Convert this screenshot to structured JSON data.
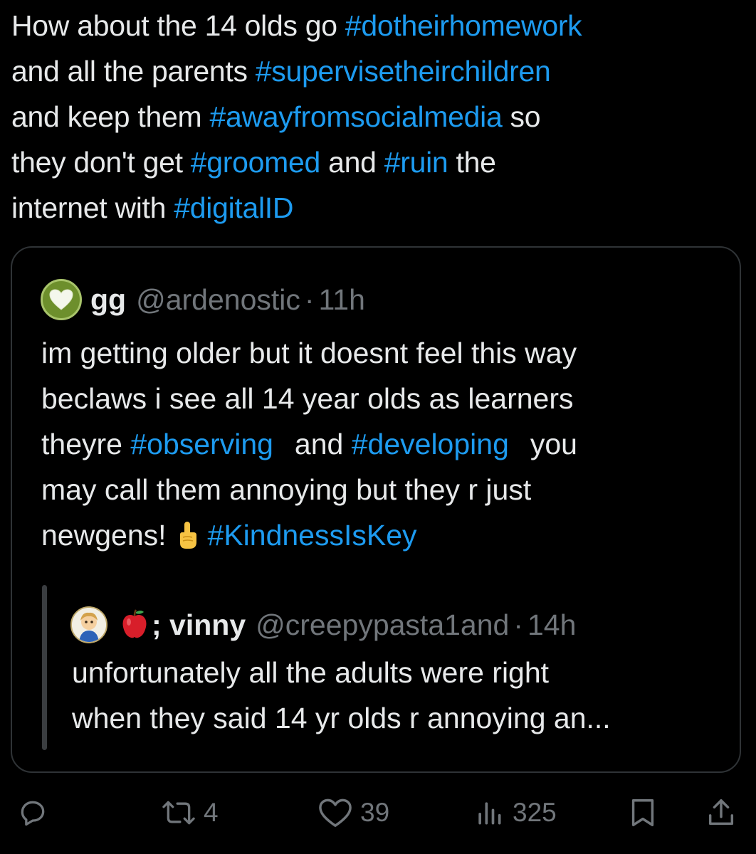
{
  "tweet": {
    "line1": {
      "t1": "How about the 14 olds go ",
      "h1": "#dotheirhomework"
    },
    "line2": {
      "t1": "and all the parents ",
      "h1": "#supervisetheirchildren"
    },
    "line3": {
      "t1": "and keep them ",
      "h1": "#awayfromsocialmedia",
      "t2": " so"
    },
    "line4": {
      "t1": "they don't get ",
      "h1": "#groomed",
      "t2": " and ",
      "h2": "#ruin",
      "t3": " the"
    },
    "line5": {
      "t1": "internet with ",
      "h1": "#digitalID"
    }
  },
  "quote": {
    "name": "gg",
    "handle": "@ardenostic",
    "dot": "·",
    "time": "11h",
    "line1": "im getting older but it doesnt feel this way",
    "line2": "beclaws i see all 14 year olds as learners",
    "line3": {
      "t1": "theyre ",
      "h1": "#observing",
      "t2": "and ",
      "h2": "#developing",
      "t3": "you"
    },
    "line4": "may call them annoying but they r just",
    "line5": {
      "t1": "newgens!",
      "h1": "#KindnessIsKey"
    }
  },
  "nested_quote": {
    "name": "; vinny",
    "handle": "@creepypasta1and",
    "dot": "·",
    "time": "14h",
    "line1": "unfortunately all the adults were right",
    "line2": "when they said 14 yr olds r annoying an..."
  },
  "actions": {
    "retweets": "4",
    "likes": "39",
    "views": "325"
  },
  "colors": {
    "hashtag": "#1d9bf0",
    "text": "#e7e9ea",
    "muted": "#71767b",
    "border": "#2f3336",
    "background": "#000000"
  },
  "icons": [
    "reply-icon",
    "retweet-icon",
    "like-icon",
    "views-icon",
    "bookmark-icon",
    "share-icon",
    "heart-avatar",
    "apple-emoji",
    "point-up-emoji"
  ]
}
